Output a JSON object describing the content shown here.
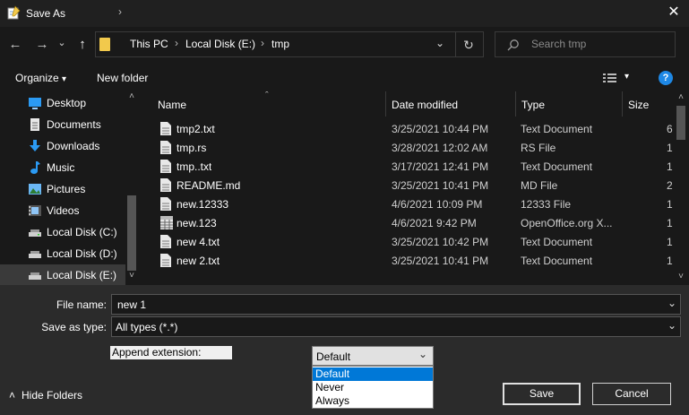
{
  "window": {
    "title": "Save As",
    "close_glyph": "✕"
  },
  "nav": {
    "back_glyph": "←",
    "forward_glyph": "→",
    "recent_glyph": "⌄",
    "up_glyph": "↑",
    "breadcrumb": [
      "This PC",
      "Local Disk (E:)",
      "tmp"
    ],
    "separator": "›",
    "dropdown_glyph": "⌄",
    "refresh_glyph": "↻",
    "search_placeholder": "Search tmp"
  },
  "toolbar": {
    "organize_label": "Organize",
    "organize_caret": "▾",
    "new_folder_label": "New folder",
    "view_caret": "▾",
    "help_glyph": "?"
  },
  "sidebar": {
    "items": [
      {
        "label": "Desktop",
        "icon": "desktop-icon"
      },
      {
        "label": "Documents",
        "icon": "documents-icon"
      },
      {
        "label": "Downloads",
        "icon": "downloads-icon"
      },
      {
        "label": "Music",
        "icon": "music-icon"
      },
      {
        "label": "Pictures",
        "icon": "pictures-icon"
      },
      {
        "label": "Videos",
        "icon": "videos-icon"
      },
      {
        "label": "Local Disk (C:)",
        "icon": "drive-icon"
      },
      {
        "label": "Local Disk (D:)",
        "icon": "drive-icon"
      },
      {
        "label": "Local Disk (E:)",
        "icon": "drive-icon"
      }
    ],
    "scroll_up_glyph": "˄",
    "scroll_down_glyph": "˅"
  },
  "files": {
    "columns": {
      "name": "Name",
      "date": "Date modified",
      "type": "Type",
      "size": "Size"
    },
    "sort_glyph": "ˆ",
    "rows": [
      {
        "name": "tmp2.txt",
        "date": "3/25/2021 10:44 PM",
        "type": "Text Document",
        "size": "6"
      },
      {
        "name": "tmp.rs",
        "date": "3/28/2021 12:02 AM",
        "type": "RS File",
        "size": "1"
      },
      {
        "name": "tmp..txt",
        "date": "3/17/2021 12:41 PM",
        "type": "Text Document",
        "size": "1"
      },
      {
        "name": "README.md",
        "date": "3/25/2021 10:41 PM",
        "type": "MD File",
        "size": "2"
      },
      {
        "name": "new.12333",
        "date": "4/6/2021 10:09 PM",
        "type": "12333 File",
        "size": "1"
      },
      {
        "name": "new.123",
        "date": "4/6/2021 9:42 PM",
        "type": "OpenOffice.org X...",
        "size": "1"
      },
      {
        "name": "new 4.txt",
        "date": "3/25/2021 10:42 PM",
        "type": "Text Document",
        "size": "1"
      },
      {
        "name": "new 2.txt",
        "date": "3/25/2021 10:41 PM",
        "type": "Text Document",
        "size": "1"
      }
    ],
    "scroll_up_glyph": "˄",
    "scroll_down_glyph": "˅"
  },
  "form": {
    "file_name_label": "File name:",
    "file_name_value": "new 1",
    "save_as_type_label": "Save as type:",
    "save_as_type_value": "All types (*.*)",
    "dropdown_glyph": "⌄",
    "append_extension_label": "Append extension:",
    "append_extension_value": "Default",
    "append_extension_options": [
      "Default",
      "Never",
      "Always"
    ]
  },
  "footer": {
    "hide_folders_glyph": "˄",
    "hide_folders_label": "Hide Folders",
    "save_label": "Save",
    "cancel_label": "Cancel"
  },
  "colors": {
    "accent": "#0078d7",
    "help": "#1e88e5",
    "folder": "#f2c94c"
  }
}
